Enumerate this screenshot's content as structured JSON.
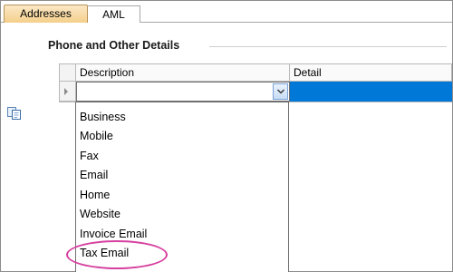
{
  "tabs": [
    {
      "label": "Addresses",
      "active": true
    },
    {
      "label": "AML",
      "active": false
    }
  ],
  "section": {
    "title": "Phone and Other Details"
  },
  "grid": {
    "columns": [
      "Description",
      "Detail"
    ],
    "current_row": {
      "description": "",
      "detail": ""
    }
  },
  "dropdown": {
    "options": [
      "Business",
      "Mobile",
      "Fax",
      "Email",
      "Home",
      "Website",
      "Invoice Email",
      "Tax Email"
    ],
    "highlighted": "Tax Email"
  },
  "colors": {
    "active_tab": "#f4cf8b",
    "selection": "#0078d7",
    "highlight_annotation": "#d6409f"
  },
  "icons": [
    "copy-icon",
    "row-pointer-icon",
    "chevron-down-icon"
  ]
}
